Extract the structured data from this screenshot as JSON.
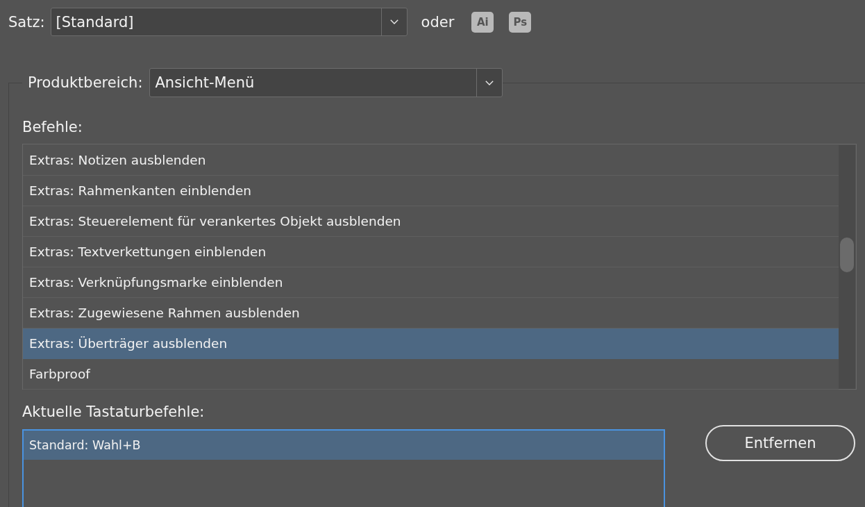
{
  "set_row": {
    "label": "Satz:",
    "dropdown": {
      "value": "[Standard]"
    },
    "separator": "oder",
    "app_buttons": [
      {
        "label": "Ai"
      },
      {
        "label": "Ps"
      }
    ]
  },
  "product_area": {
    "label": "Produktbereich:",
    "dropdown": {
      "value": "Ansicht-Menü"
    }
  },
  "commands": {
    "label": "Befehle:",
    "items": [
      {
        "label": "Extras: Notizen ausblenden",
        "selected": false
      },
      {
        "label": "Extras: Rahmenkanten einblenden",
        "selected": false
      },
      {
        "label": "Extras: Steuerelement für verankertes Objekt ausblenden",
        "selected": false
      },
      {
        "label": "Extras: Textverkettungen einblenden",
        "selected": false
      },
      {
        "label": "Extras: Verknüpfungsmarke einblenden",
        "selected": false
      },
      {
        "label": "Extras: Zugewiesene Rahmen ausblenden",
        "selected": false
      },
      {
        "label": "Extras: Überträger ausblenden",
        "selected": true
      },
      {
        "label": "Farbproof",
        "selected": false
      }
    ]
  },
  "current_shortcuts": {
    "label": "Aktuelle Tastaturbefehle:",
    "focused": true,
    "items": [
      {
        "label": "Standard: Wahl+B",
        "selected": true
      }
    ]
  },
  "remove_button": {
    "label": "Entfernen"
  }
}
